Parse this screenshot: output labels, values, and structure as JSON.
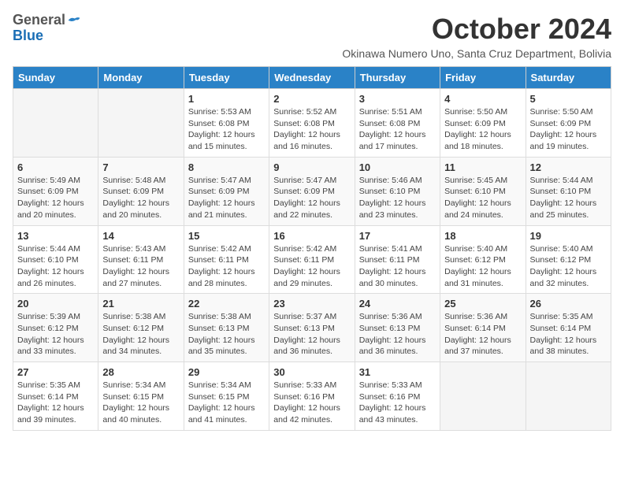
{
  "header": {
    "logo_general": "General",
    "logo_blue": "Blue",
    "month_title": "October 2024",
    "subtitle": "Okinawa Numero Uno, Santa Cruz Department, Bolivia"
  },
  "days_of_week": [
    "Sunday",
    "Monday",
    "Tuesday",
    "Wednesday",
    "Thursday",
    "Friday",
    "Saturday"
  ],
  "weeks": [
    [
      {
        "day": "",
        "info": ""
      },
      {
        "day": "",
        "info": ""
      },
      {
        "day": "1",
        "sunrise": "5:53 AM",
        "sunset": "6:08 PM",
        "daylight": "12 hours and 15 minutes."
      },
      {
        "day": "2",
        "sunrise": "5:52 AM",
        "sunset": "6:08 PM",
        "daylight": "12 hours and 16 minutes."
      },
      {
        "day": "3",
        "sunrise": "5:51 AM",
        "sunset": "6:08 PM",
        "daylight": "12 hours and 17 minutes."
      },
      {
        "day": "4",
        "sunrise": "5:50 AM",
        "sunset": "6:09 PM",
        "daylight": "12 hours and 18 minutes."
      },
      {
        "day": "5",
        "sunrise": "5:50 AM",
        "sunset": "6:09 PM",
        "daylight": "12 hours and 19 minutes."
      }
    ],
    [
      {
        "day": "6",
        "sunrise": "5:49 AM",
        "sunset": "6:09 PM",
        "daylight": "12 hours and 20 minutes."
      },
      {
        "day": "7",
        "sunrise": "5:48 AM",
        "sunset": "6:09 PM",
        "daylight": "12 hours and 20 minutes."
      },
      {
        "day": "8",
        "sunrise": "5:47 AM",
        "sunset": "6:09 PM",
        "daylight": "12 hours and 21 minutes."
      },
      {
        "day": "9",
        "sunrise": "5:47 AM",
        "sunset": "6:09 PM",
        "daylight": "12 hours and 22 minutes."
      },
      {
        "day": "10",
        "sunrise": "5:46 AM",
        "sunset": "6:10 PM",
        "daylight": "12 hours and 23 minutes."
      },
      {
        "day": "11",
        "sunrise": "5:45 AM",
        "sunset": "6:10 PM",
        "daylight": "12 hours and 24 minutes."
      },
      {
        "day": "12",
        "sunrise": "5:44 AM",
        "sunset": "6:10 PM",
        "daylight": "12 hours and 25 minutes."
      }
    ],
    [
      {
        "day": "13",
        "sunrise": "5:44 AM",
        "sunset": "6:10 PM",
        "daylight": "12 hours and 26 minutes."
      },
      {
        "day": "14",
        "sunrise": "5:43 AM",
        "sunset": "6:11 PM",
        "daylight": "12 hours and 27 minutes."
      },
      {
        "day": "15",
        "sunrise": "5:42 AM",
        "sunset": "6:11 PM",
        "daylight": "12 hours and 28 minutes."
      },
      {
        "day": "16",
        "sunrise": "5:42 AM",
        "sunset": "6:11 PM",
        "daylight": "12 hours and 29 minutes."
      },
      {
        "day": "17",
        "sunrise": "5:41 AM",
        "sunset": "6:11 PM",
        "daylight": "12 hours and 30 minutes."
      },
      {
        "day": "18",
        "sunrise": "5:40 AM",
        "sunset": "6:12 PM",
        "daylight": "12 hours and 31 minutes."
      },
      {
        "day": "19",
        "sunrise": "5:40 AM",
        "sunset": "6:12 PM",
        "daylight": "12 hours and 32 minutes."
      }
    ],
    [
      {
        "day": "20",
        "sunrise": "5:39 AM",
        "sunset": "6:12 PM",
        "daylight": "12 hours and 33 minutes."
      },
      {
        "day": "21",
        "sunrise": "5:38 AM",
        "sunset": "6:12 PM",
        "daylight": "12 hours and 34 minutes."
      },
      {
        "day": "22",
        "sunrise": "5:38 AM",
        "sunset": "6:13 PM",
        "daylight": "12 hours and 35 minutes."
      },
      {
        "day": "23",
        "sunrise": "5:37 AM",
        "sunset": "6:13 PM",
        "daylight": "12 hours and 36 minutes."
      },
      {
        "day": "24",
        "sunrise": "5:36 AM",
        "sunset": "6:13 PM",
        "daylight": "12 hours and 36 minutes."
      },
      {
        "day": "25",
        "sunrise": "5:36 AM",
        "sunset": "6:14 PM",
        "daylight": "12 hours and 37 minutes."
      },
      {
        "day": "26",
        "sunrise": "5:35 AM",
        "sunset": "6:14 PM",
        "daylight": "12 hours and 38 minutes."
      }
    ],
    [
      {
        "day": "27",
        "sunrise": "5:35 AM",
        "sunset": "6:14 PM",
        "daylight": "12 hours and 39 minutes."
      },
      {
        "day": "28",
        "sunrise": "5:34 AM",
        "sunset": "6:15 PM",
        "daylight": "12 hours and 40 minutes."
      },
      {
        "day": "29",
        "sunrise": "5:34 AM",
        "sunset": "6:15 PM",
        "daylight": "12 hours and 41 minutes."
      },
      {
        "day": "30",
        "sunrise": "5:33 AM",
        "sunset": "6:16 PM",
        "daylight": "12 hours and 42 minutes."
      },
      {
        "day": "31",
        "sunrise": "5:33 AM",
        "sunset": "6:16 PM",
        "daylight": "12 hours and 43 minutes."
      },
      {
        "day": "",
        "info": ""
      },
      {
        "day": "",
        "info": ""
      }
    ]
  ],
  "labels": {
    "sunrise": "Sunrise:",
    "sunset": "Sunset:",
    "daylight": "Daylight:"
  }
}
